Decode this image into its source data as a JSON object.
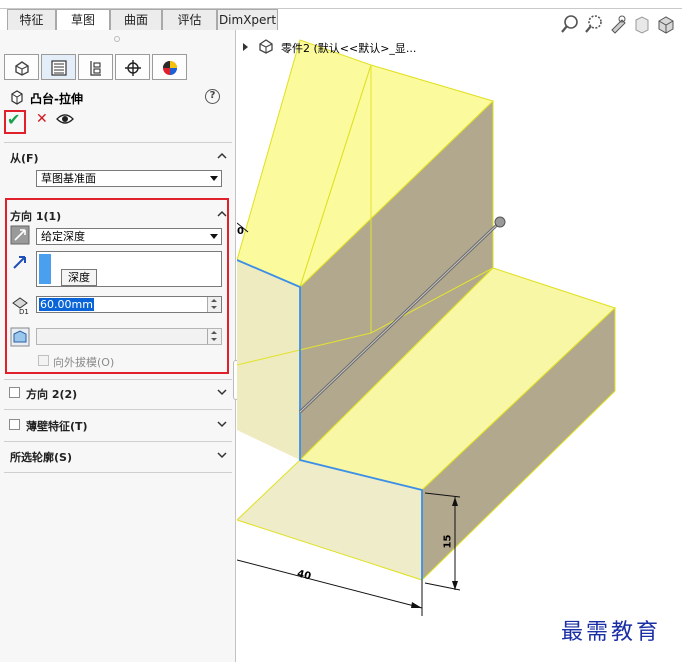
{
  "tabs": [
    {
      "label": "特征",
      "active": false
    },
    {
      "label": "草图",
      "active": true
    },
    {
      "label": "曲面",
      "active": false
    },
    {
      "label": "评估",
      "active": false
    },
    {
      "label": "DimXpert",
      "active": false
    }
  ],
  "panel": {
    "icon_tabs": [
      "feature-manager-icon",
      "property-manager-icon",
      "configuration-manager-icon",
      "dimxpert-manager-icon",
      "appearance-icon"
    ],
    "feature_title": "凸台-拉伸",
    "help": "?",
    "ok": "✔",
    "cancel": "✕",
    "from": {
      "label": "从(F)",
      "value": "草图基准面"
    },
    "direction1": {
      "label": "方向 1(1)",
      "end_condition": "给定深度",
      "tooltip": "深度",
      "depth": "60.00mm",
      "draft_label": "向外拔模(O)"
    },
    "direction2": {
      "label": "方向 2(2)"
    },
    "thin": {
      "label": "薄壁特征(T)"
    },
    "contours": {
      "label": "所选轮廓(S)"
    }
  },
  "viewport": {
    "tree_text": "零件2  (默认<<默认>_显...",
    "dims": {
      "width": "40",
      "height": "15",
      "partial": "0"
    },
    "watermark": "最需教育"
  },
  "colors": {
    "accent_red": "#e0202a",
    "ok_green": "#16a34a",
    "selection_blue": "#0a64d8",
    "model_yellow": "#ffff66",
    "model_face": "#b2a88e"
  }
}
